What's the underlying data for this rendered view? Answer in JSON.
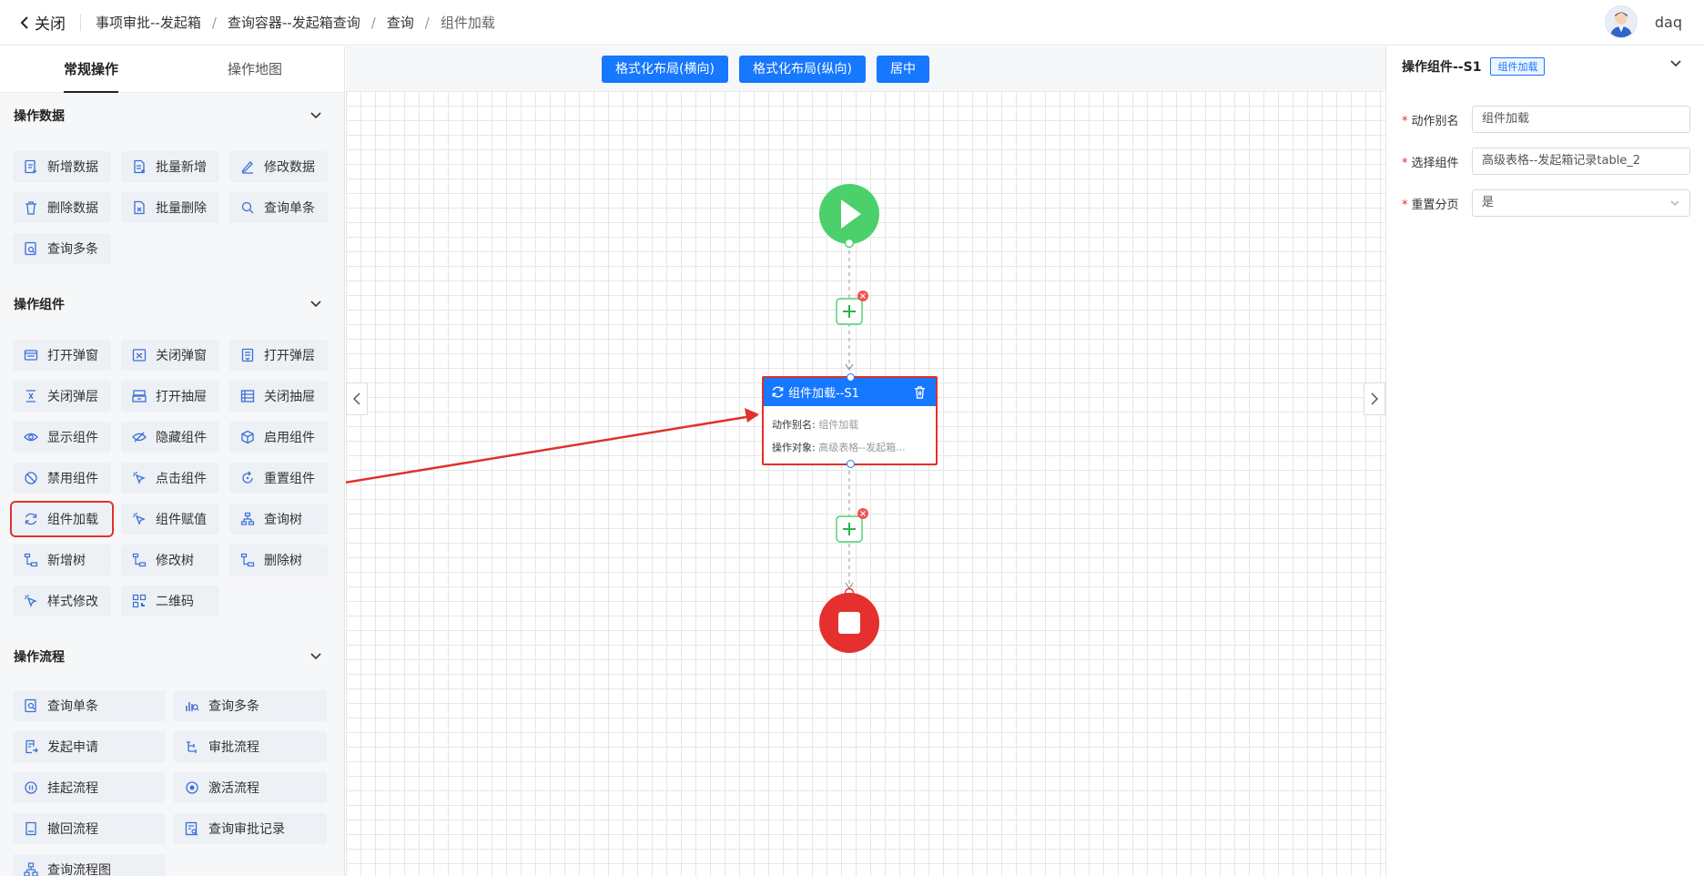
{
  "topbar": {
    "close_label": "关闭",
    "breadcrumbs": [
      "事项审批--发起箱",
      "查询容器--发起箱查询",
      "查询",
      "组件加载"
    ],
    "username": "daq"
  },
  "left": {
    "tabs": [
      "常规操作",
      "操作地图"
    ],
    "sections": [
      {
        "title": "操作数据",
        "items": [
          "新增数据",
          "批量新增",
          "修改数据",
          "删除数据",
          "批量删除",
          "查询单条",
          "查询多条"
        ]
      },
      {
        "title": "操作组件",
        "items": [
          "打开弹窗",
          "关闭弹窗",
          "打开弹层",
          "关闭弹层",
          "打开抽屉",
          "关闭抽屉",
          "显示组件",
          "隐藏组件",
          "启用组件",
          "禁用组件",
          "点击组件",
          "重置组件",
          "组件加载",
          "组件赋值",
          "查询树",
          "新增树",
          "修改树",
          "删除树",
          "样式修改",
          "二维码"
        ]
      },
      {
        "title": "操作流程",
        "items": [
          "查询单条",
          "查询多条",
          "发起申请",
          "审批流程",
          "挂起流程",
          "激活流程",
          "撤回流程",
          "查询审批记录",
          "查询流程图"
        ]
      }
    ]
  },
  "canvas": {
    "toolbar": {
      "format_h": "格式化布局(横向)",
      "format_v": "格式化布局(纵向)",
      "center": "居中"
    },
    "node": {
      "title": "组件加载--S1",
      "alias_label": "动作别名:",
      "alias_value": "组件加载",
      "target_label": "操作对象:",
      "target_value": "高级表格--发起箱..."
    }
  },
  "right": {
    "title": "操作组件--S1",
    "tag": "组件加载",
    "fields": [
      {
        "label": "动作别名",
        "value": "组件加载"
      },
      {
        "label": "选择组件",
        "value": "高级表格--发起箱记录table_2"
      },
      {
        "label": "重置分页",
        "value": "是"
      }
    ]
  },
  "colors": {
    "primary": "#1677ff",
    "start": "#4cd06b",
    "end": "#e5302f",
    "annotation": "#e0312b"
  }
}
